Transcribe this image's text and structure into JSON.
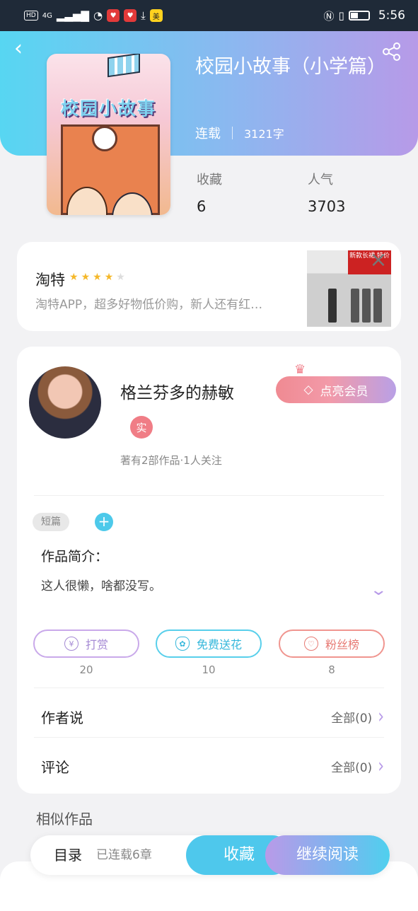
{
  "status_bar": {
    "badge_hd": "HD",
    "network": "4G",
    "app1": "♥",
    "app2": "♥",
    "app3": "美",
    "time": "5:56"
  },
  "book": {
    "title": "校园小故事（小学篇）",
    "status": "连载",
    "word_count": "3121字",
    "cover_text": "校园小故事",
    "stats": [
      {
        "label": "收藏",
        "value": "6"
      },
      {
        "label": "人气",
        "value": "3703"
      }
    ]
  },
  "ad": {
    "name": "淘特",
    "rating": 4,
    "rating_max": 5,
    "description": "淘特APP，超多好物低价购，新人还有红…",
    "image_banner": "新款长裙 特价"
  },
  "author": {
    "name": "格兰芬多的赫敏",
    "vip_button": "点亮会员",
    "verify_badge": "实",
    "subtitle": "著有2部作品·1人关注"
  },
  "intro": {
    "tag": "短篇",
    "add": "+",
    "label": "作品简介：",
    "text": "这人很懒，啥都没写。"
  },
  "actions": [
    {
      "label": "打赏",
      "icon": "yen-coin-icon",
      "count": "20"
    },
    {
      "label": "免费送花",
      "icon": "flower-icon",
      "count": "10"
    },
    {
      "label": "粉丝榜",
      "icon": "fans-icon",
      "count": "8"
    }
  ],
  "rows": [
    {
      "label": "作者说",
      "right": "全部(0)"
    },
    {
      "label": "评论",
      "right": "全部(0)"
    }
  ],
  "similar_label": "相似作品",
  "bottom_bar": {
    "toc": "目录",
    "toc_sub": "已连载6章",
    "favorite": "收藏",
    "continue": "继续阅读"
  },
  "colors": {
    "accent_cyan": "#4ec8ec",
    "accent_purple": "#b79ae8",
    "accent_pink": "#f07d86"
  }
}
